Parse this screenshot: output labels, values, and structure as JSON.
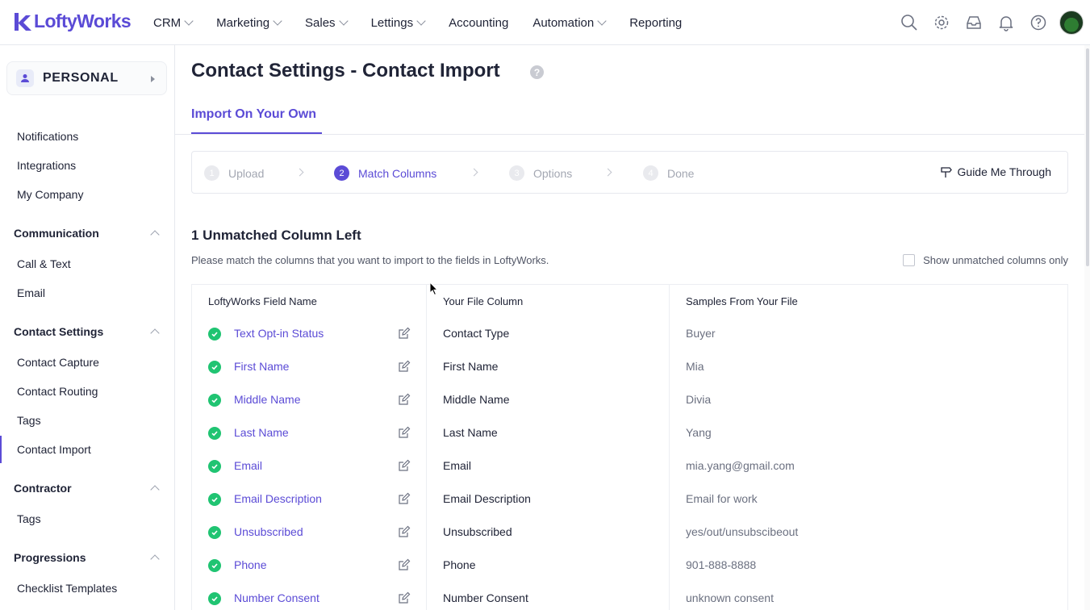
{
  "brand": {
    "name": "LoftyWorks",
    "accent": "#5b4bd6",
    "success": "#20c472"
  },
  "nav": {
    "items": [
      {
        "label": "CRM",
        "dropdown": true
      },
      {
        "label": "Marketing",
        "dropdown": true
      },
      {
        "label": "Sales",
        "dropdown": true
      },
      {
        "label": "Lettings",
        "dropdown": true
      },
      {
        "label": "Accounting",
        "dropdown": false
      },
      {
        "label": "Automation",
        "dropdown": true
      },
      {
        "label": "Reporting",
        "dropdown": false
      }
    ],
    "icons": [
      "search-icon",
      "gear-icon",
      "inbox-icon",
      "bell-icon",
      "help-icon",
      "avatar"
    ]
  },
  "sidebar": {
    "switcher": "PERSONAL",
    "top_items": [
      "Notifications",
      "Integrations",
      "My Company"
    ],
    "sections": [
      {
        "title": "Communication",
        "items": [
          "Call & Text",
          "Email"
        ]
      },
      {
        "title": "Contact Settings",
        "items": [
          "Contact Capture",
          "Contact Routing",
          "Tags",
          "Contact Import"
        ]
      },
      {
        "title": "Contractor",
        "items": [
          "Tags"
        ]
      },
      {
        "title": "Progressions",
        "items": [
          "Checklist Templates"
        ]
      }
    ],
    "active": "Contact Import"
  },
  "page": {
    "title": "Contact Settings - Contact Import",
    "help": "?",
    "tab": "Import On Your Own"
  },
  "steps": {
    "items": [
      {
        "num": "1",
        "label": "Upload"
      },
      {
        "num": "2",
        "label": "Match Columns"
      },
      {
        "num": "3",
        "label": "Options"
      },
      {
        "num": "4",
        "label": "Done"
      }
    ],
    "active_step": 2,
    "guide": "Guide Me Through"
  },
  "matching": {
    "heading": "1 Unmatched Column Left",
    "description": "Please match the columns that you want to import to the fields in LoftyWorks.",
    "toggle_label": "Show unmatched columns only",
    "headers": [
      "LoftyWorks Field Name",
      "Your File Column",
      "Samples From Your File"
    ],
    "rows": [
      {
        "field": "Text Opt-in Status",
        "file": "Contact Type",
        "sample": "Buyer"
      },
      {
        "field": "First Name",
        "file": "First Name",
        "sample": "Mia"
      },
      {
        "field": "Middle Name",
        "file": "Middle Name",
        "sample": "Divia"
      },
      {
        "field": "Last Name",
        "file": "Last Name",
        "sample": "Yang"
      },
      {
        "field": "Email",
        "file": "Email",
        "sample": "mia.yang@gmail.com"
      },
      {
        "field": "Email Description",
        "file": "Email Description",
        "sample": "Email for work"
      },
      {
        "field": "Unsubscribed",
        "file": "Unsubscribed",
        "sample": "yes/out/unsubscibeout"
      },
      {
        "field": "Phone",
        "file": "Phone",
        "sample": "901-888-8888"
      },
      {
        "field": "Number Consent",
        "file": "Number Consent",
        "sample": "unknown consent"
      }
    ]
  }
}
